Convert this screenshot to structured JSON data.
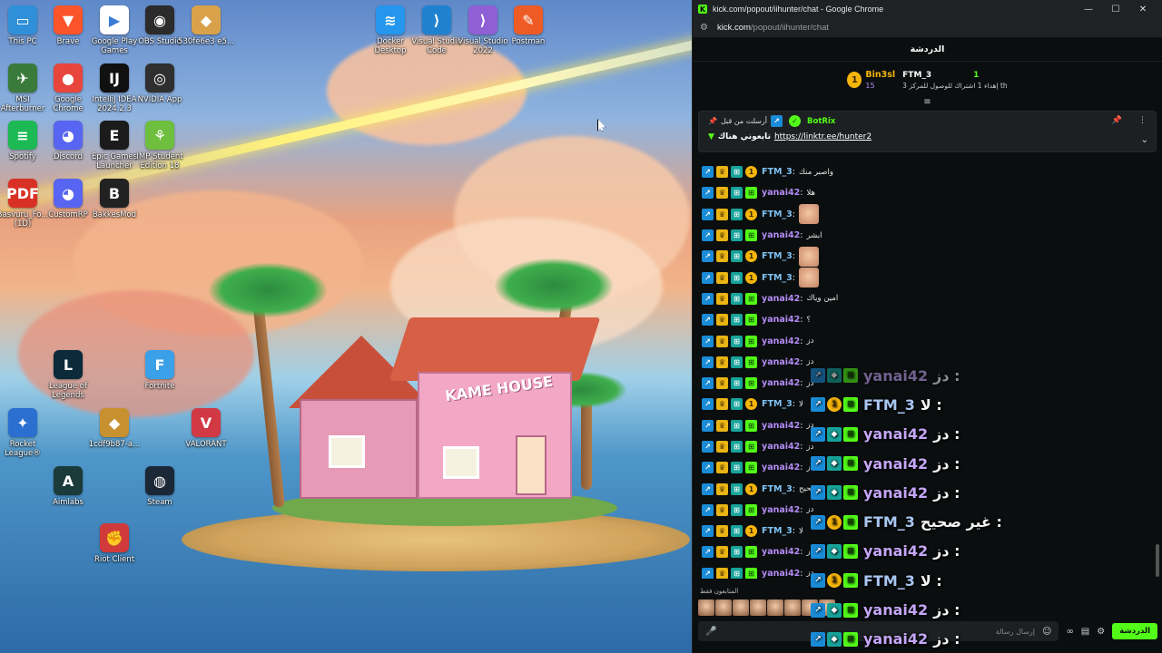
{
  "desktop": {
    "icons": [
      {
        "label": "This PC",
        "icon": "monitor-icon",
        "color": "#2f8fd8",
        "glyph": "▭"
      },
      {
        "label": "Brave",
        "icon": "brave-icon",
        "color": "#fb542b",
        "glyph": "▼"
      },
      {
        "label": "Google Play Games",
        "icon": "document-icon",
        "color": "#ffffff",
        "glyph": "▶"
      },
      {
        "label": "OBS Studio",
        "icon": "obs-icon",
        "color": "#2b2b2b",
        "glyph": "◉"
      },
      {
        "label": "530fe6e3 e5...",
        "icon": "image-icon",
        "color": "#d9a24a",
        "glyph": "◆"
      },
      {
        "label": "Docker Desktop",
        "icon": "docker-icon",
        "color": "#2496ed",
        "glyph": "≋"
      },
      {
        "label": "Visual Studio Code",
        "icon": "vscode-icon",
        "color": "#1f82d1",
        "glyph": "⟩"
      },
      {
        "label": "Visual Studio 2022",
        "icon": "visualstudio-icon",
        "color": "#8f5fd6",
        "glyph": "⟩"
      },
      {
        "label": "Postman",
        "icon": "postman-icon",
        "color": "#ef5b25",
        "glyph": "✎"
      },
      {
        "label": "MSI Afterburner",
        "icon": "msi-icon",
        "color": "#3a7a3a",
        "glyph": "✈"
      },
      {
        "label": "Google Chrome",
        "icon": "chrome-icon",
        "color": "#e8453c",
        "glyph": "●"
      },
      {
        "label": "IntelliJ IDEA 2024.2.3",
        "icon": "intellij-icon",
        "color": "#111111",
        "glyph": "IJ"
      },
      {
        "label": "NVIDIA App",
        "icon": "nvidia-icon",
        "color": "#2f2f2f",
        "glyph": "◎"
      },
      {
        "label": "Spotify",
        "icon": "spotify-icon",
        "color": "#1db954",
        "glyph": "≡"
      },
      {
        "label": "Discord",
        "icon": "discord-icon",
        "color": "#5865f2",
        "glyph": "◕"
      },
      {
        "label": "Epic Games Launcher",
        "icon": "epic-icon",
        "color": "#1b1b1b",
        "glyph": "E"
      },
      {
        "label": "IMP Student Edition 18",
        "icon": "imp-icon",
        "color": "#6fbf3f",
        "glyph": "⚘"
      },
      {
        "label": "Basvuru_Fo... (1D)",
        "icon": "pdf-icon",
        "color": "#d93025",
        "glyph": "PDF"
      },
      {
        "label": "CustomRP",
        "icon": "discord-icon",
        "color": "#5865f2",
        "glyph": "◕"
      },
      {
        "label": "BakkesMod",
        "icon": "bakkesmod-icon",
        "color": "#222222",
        "glyph": "B"
      },
      {
        "label": "League of Legends",
        "icon": "league-icon",
        "color": "#0b2a3a",
        "glyph": "L"
      },
      {
        "label": "Fortnite",
        "icon": "fortnite-icon",
        "color": "#3aa0e8",
        "glyph": "F"
      },
      {
        "label": "Rocket League®",
        "icon": "rocketleague-icon",
        "color": "#2b6fd0",
        "glyph": "✦"
      },
      {
        "label": "1cdf9b87-a...",
        "icon": "image-icon",
        "color": "#c7912f",
        "glyph": "◆"
      },
      {
        "label": "VALORANT",
        "icon": "valorant-icon",
        "color": "#d13a45",
        "glyph": "V"
      },
      {
        "label": "Aimlabs",
        "icon": "aimlabs-icon",
        "color": "#1b3a3a",
        "glyph": "A"
      },
      {
        "label": "Steam",
        "icon": "steam-icon",
        "color": "#1b2838",
        "glyph": "◍"
      },
      {
        "label": "Riot Client",
        "icon": "riot-icon",
        "color": "#d13a3a",
        "glyph": "✊"
      }
    ],
    "wallpaper_text": "KAME HOUSE"
  },
  "browser": {
    "window_title": "kick.com/popout/iihunter/chat - Google Chrome",
    "url_host": "kick.com",
    "url_path": "/popout/iihunter/chat",
    "chat_header": "الدردشة",
    "leaderboard": {
      "first": {
        "rank": "1",
        "name": "Bin3sl",
        "count": "15"
      },
      "second": {
        "name": "FTM_3",
        "count": "1",
        "note": "إهداء 1 اشتراك للوصول للمركز 3 th"
      }
    },
    "pinned": {
      "sent_by_label": "أرسلت من قبل",
      "bot_name": "BotRix",
      "message_text": "تابعوني هناك",
      "link": "https://linktr.ee/hunter2"
    },
    "messages": [
      {
        "user": "FTM_3",
        "type": "ftm",
        "text": "واصبر منك",
        "emote": false
      },
      {
        "user": "yanai42",
        "type": "yan",
        "text": "هلا",
        "emote": false
      },
      {
        "user": "FTM_3",
        "type": "ftm",
        "text": "",
        "emote": true
      },
      {
        "user": "yanai42",
        "type": "yan",
        "text": "ابشر",
        "emote": false
      },
      {
        "user": "FTM_3",
        "type": "ftm",
        "text": "",
        "emote": true
      },
      {
        "user": "FTM_3",
        "type": "ftm",
        "text": "",
        "emote": true
      },
      {
        "user": "yanai42",
        "type": "yan",
        "text": "امين وياك",
        "emote": false
      },
      {
        "user": "yanai42",
        "type": "yan",
        "text": "؟",
        "emote": false
      },
      {
        "user": "yanai42",
        "type": "yan",
        "text": "دز",
        "emote": false
      },
      {
        "user": "yanai42",
        "type": "yan",
        "text": "دز",
        "emote": false
      },
      {
        "user": "yanai42",
        "type": "yan",
        "text": "دز",
        "emote": false
      },
      {
        "user": "FTM_3",
        "type": "ftm",
        "text": "لا",
        "emote": false
      },
      {
        "user": "yanai42",
        "type": "yan",
        "text": "دز",
        "emote": false
      },
      {
        "user": "yanai42",
        "type": "yan",
        "text": "دز",
        "emote": false
      },
      {
        "user": "yanai42",
        "type": "yan",
        "text": "دز",
        "emote": false
      },
      {
        "user": "FTM_3",
        "type": "ftm",
        "text": "صحيح",
        "emote": false
      },
      {
        "user": "yanai42",
        "type": "yan",
        "text": "دز",
        "emote": false
      },
      {
        "user": "FTM_3",
        "type": "ftm",
        "text": "لا",
        "emote": false
      },
      {
        "user": "yanai42",
        "type": "yan",
        "text": "دز",
        "emote": false
      },
      {
        "user": "yanai42",
        "type": "yan",
        "text": "دز",
        "emote": false
      }
    ],
    "overlay": [
      {
        "user": "yanai42",
        "type": "yan",
        "text": "دز :",
        "faded": true
      },
      {
        "user": "FTM_3",
        "type": "ftm",
        "text": "لا :",
        "faded": false
      },
      {
        "user": "yanai42",
        "type": "yan",
        "text": "دز :",
        "faded": false
      },
      {
        "user": "yanai42",
        "type": "yan",
        "text": "دز :",
        "faded": false
      },
      {
        "user": "yanai42",
        "type": "yan",
        "text": "دز :",
        "faded": false
      },
      {
        "user": "FTM_3",
        "type": "ftm",
        "text": "غير صحيح :",
        "faded": false
      },
      {
        "user": "yanai42",
        "type": "yan",
        "text": "دز :",
        "faded": false
      },
      {
        "user": "FTM_3",
        "type": "ftm",
        "text": "لا :",
        "faded": false
      },
      {
        "user": "yanai42",
        "type": "yan",
        "text": "دز :",
        "faded": false
      },
      {
        "user": "yanai42",
        "type": "yan",
        "text": "دز :",
        "faded": false
      }
    ],
    "subscribers_label": "المتابعون فقط",
    "chat_input_placeholder": "إرسال رسالة",
    "send_label": "الدردشة"
  },
  "colors": {
    "kick_green": "#53fc18",
    "ftm_name": "#7fc3f5",
    "yanai_name": "#b48cf6",
    "gold": "#f5b50a"
  }
}
